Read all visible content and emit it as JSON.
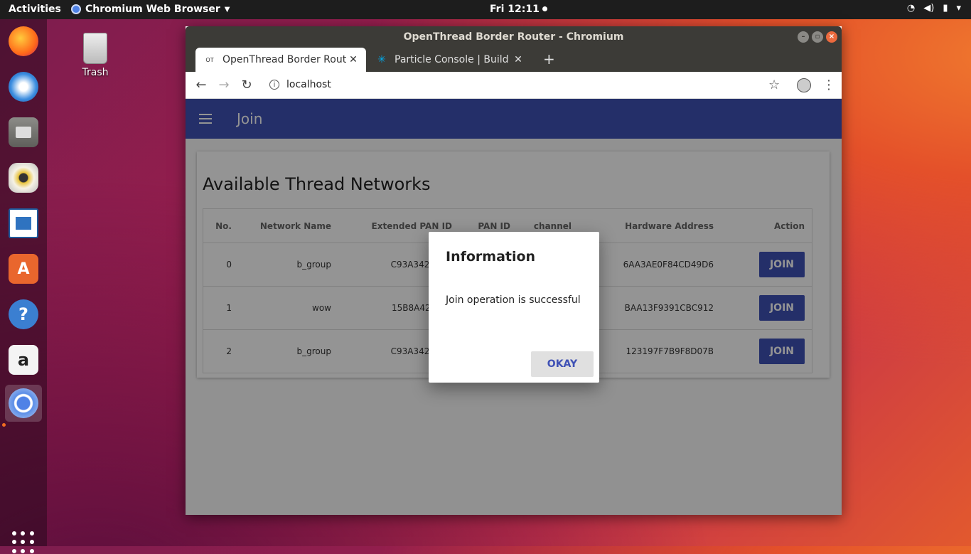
{
  "topbar": {
    "activities": "Activities",
    "app_name": "Chromium Web Browser",
    "clock": "Fri 12:11"
  },
  "desktop": {
    "trash_label": "Trash"
  },
  "dock": {
    "items": [
      "firefox-icon",
      "thunderbird-icon",
      "files-icon",
      "rhythmbox-icon",
      "writer-icon",
      "software-icon",
      "help-icon",
      "amazon-icon",
      "chromium-icon"
    ]
  },
  "window": {
    "title": "OpenThread Border Router - Chromium",
    "tabs": [
      {
        "favicon": "OT",
        "label": "OpenThread Border Rout"
      },
      {
        "favicon": "✳",
        "label": "Particle Console | Build yo"
      }
    ],
    "url": "localhost"
  },
  "page": {
    "appbar_title": "Join",
    "heading": "Available Thread Networks",
    "columns": [
      "No.",
      "Network Name",
      "Extended PAN ID",
      "PAN ID",
      "channel",
      "Hardware Address",
      "Action"
    ],
    "rows": [
      {
        "no": "0",
        "name": "b_group",
        "ext_pan": "C93A342AC47",
        "pan": "",
        "channel": "",
        "hw": "6AA3AE0F84CD49D6",
        "action": "JOIN"
      },
      {
        "no": "1",
        "name": "wow",
        "ext_pan": "15B8A423FB7",
        "pan": "",
        "channel": "",
        "hw": "BAA13F9391CBC912",
        "action": "JOIN"
      },
      {
        "no": "2",
        "name": "b_group",
        "ext_pan": "C93A342AC47",
        "pan": "",
        "channel": "",
        "hw": "123197F7B9F8D07B",
        "action": "JOIN"
      }
    ]
  },
  "dialog": {
    "title": "Information",
    "message": "Join operation is successful",
    "button": "OKAY"
  },
  "colors": {
    "appbar": "#3f51b5",
    "accent": "#3f51b5",
    "titlebar": "#3c3b37",
    "close": "#ec6a3e"
  }
}
